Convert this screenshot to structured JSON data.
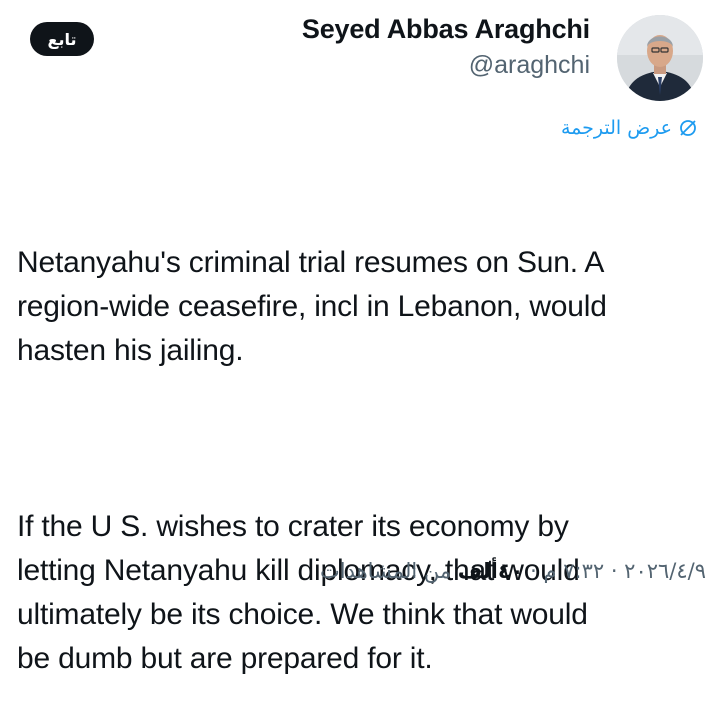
{
  "header": {
    "follow_label": "تابع",
    "display_name": "Seyed Abbas Araghchi",
    "handle": "@araghchi",
    "avatar_icon": "profile-photo"
  },
  "translate": {
    "label": "عرض الترجمة",
    "icon": "translate-icon",
    "color": "#1d9bf0"
  },
  "tweet": {
    "paragraph_1": "Netanyahu's criminal trial resumes on Sun. A\nregion-wide ceasefire, incl in Lebanon, would\nhasten his jailing.",
    "paragraph_2": "If the U S. wishes to crater its economy by\nletting Netanyahu kill diplomacy, that would\nultimately be its choice. We think that would\nbe dumb but are prepared for it."
  },
  "meta": {
    "date": "٢٠٢٦/٤/٩",
    "separator": " · ",
    "time": "٧:٣٢ م",
    "views_count": "٤٠ألف",
    "views_label": " من المشاهدات"
  }
}
